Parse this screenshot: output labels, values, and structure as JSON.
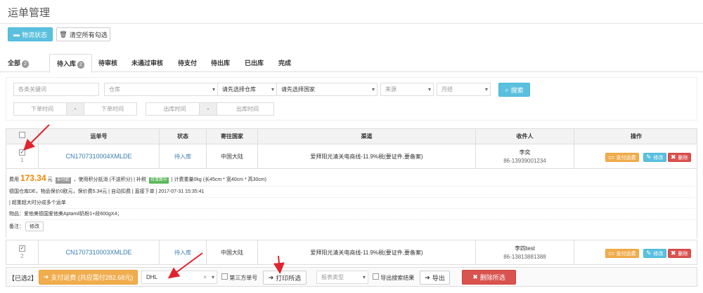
{
  "page": {
    "title": "运单管理"
  },
  "toolbar": {
    "logistics_label": "物流状态",
    "clear_label": "清空所有勾选"
  },
  "tabs": [
    {
      "label": "全部",
      "badge": "2"
    },
    {
      "label": "待入库",
      "badge": "2"
    },
    {
      "label": "待审核"
    },
    {
      "label": "未通过审核"
    },
    {
      "label": "待支付"
    },
    {
      "label": "待出库"
    },
    {
      "label": "已出库"
    },
    {
      "label": "完成"
    }
  ],
  "filters": {
    "keyword_placeholder": "各类关键词",
    "warehouse": "仓库",
    "select_warehouse": "请先选择仓库",
    "select_country": "请先选择国家",
    "source": "来源",
    "month": "月结",
    "search_label": "搜索",
    "order_time_from": "下单时间",
    "order_time_to": "下单时间",
    "out_time_from": "出库时间",
    "out_time_to": "出库时间",
    "dash": "-"
  },
  "table": {
    "headers": [
      "运单号",
      "状态",
      "寄往国家",
      "渠道",
      "收件人",
      "操作"
    ],
    "actions": {
      "pay": "支付运费",
      "edit": "修改",
      "delete": "删除"
    },
    "rows": [
      {
        "index": "1",
        "order_no": "CN1707310004XMLDE",
        "status": "待入库",
        "country": "中国大陆",
        "channel": "爱拜阳光清关电商线-11.9%税(要证件,要备案)",
        "recipient_name": "李奕",
        "recipient_phone": "86-13939001234",
        "checked": true
      },
      {
        "index": "2",
        "order_no": "CN1707310003XMLDE",
        "status": "待入库",
        "country": "中国大陆",
        "channel": "爱拜阳光清关电商线-11.9%税(要证件,要备案)",
        "recipient_name": "李四test",
        "recipient_phone": "86-13813881388",
        "checked": true
      }
    ]
  },
  "detail": {
    "fee_label": "费用",
    "fee_amount": "173.34",
    "fee_unit": "元",
    "unpaid_tag": "未付款",
    "points_text": "，使用积分抵消 (不送积分) | 补税",
    "taxing_tag": "待清算中",
    "weight_text": "| 计费重量0kg (长45cm * 宽40cm * 高30cm)",
    "line2": "德国仓库DE，物品保价0欧元，保价费5.34元 | 自动扣费 | 直接下单 | 2017-07-31 15:35:41",
    "line3": "| 超重超大时分成多个运单",
    "line4": "物品：爱他美德国爱他美Aptamil奶粉1+段600gX4；",
    "remark_label": "备注：",
    "edit_label": "修改"
  },
  "footer": {
    "selected_label": "【已选2】",
    "pay_label": "支付运费 (共应需付282.68元)",
    "carrier_value": "DHL",
    "third_party_label": "第三方单号",
    "print_label": "打印所选",
    "report_type": "报表类型",
    "export_search_label": "导出搜索结果",
    "export_label": "导出",
    "delete_label": "删除所选"
  },
  "colors": {
    "info": "#5bc0de",
    "warning": "#f0ad4e",
    "danger": "#d9534f",
    "arrow": "#e0242f",
    "price": "#f08300"
  }
}
